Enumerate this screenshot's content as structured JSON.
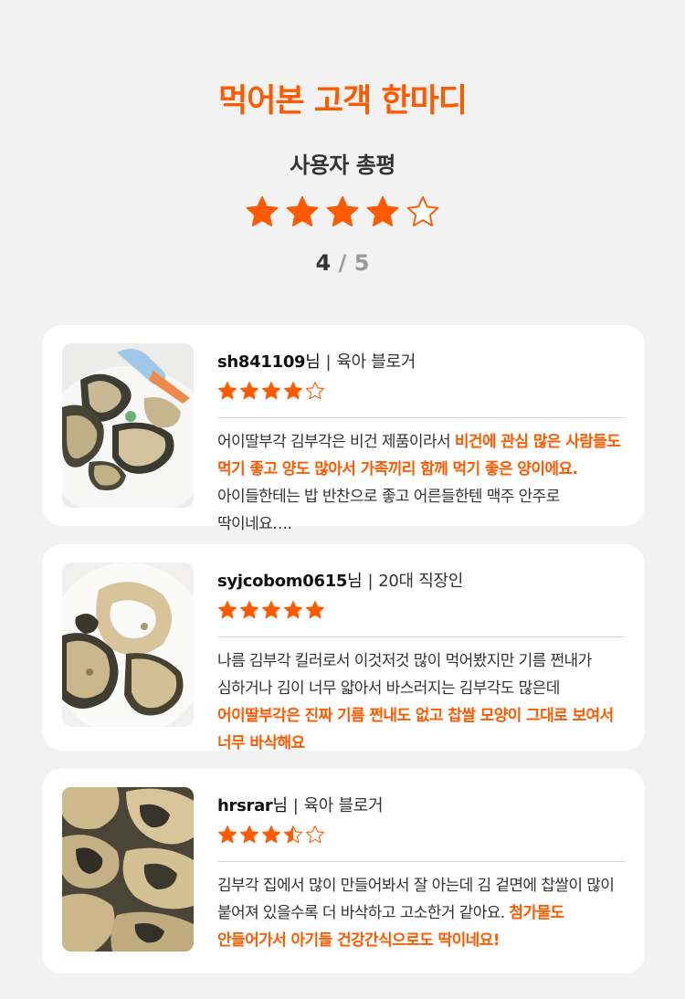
{
  "header": {
    "title": "먹어본 고객 한마디",
    "subtitle": "사용자 총평",
    "rating": 4,
    "score": "4",
    "score_sep": "/",
    "score_max": "5"
  },
  "colors": {
    "accent": "#ff5a00",
    "card_bg": "#ffffff",
    "page_bg": "#f2f2f2"
  },
  "reviews": [
    {
      "user_id": "sh841109",
      "suffix": "님",
      "separator": "|",
      "role": "육아 블로거",
      "rating": 4,
      "text_before": "어이딸부각 김부각은 비건 제품이라서 ",
      "highlight": "비건에 관심 많은 사람들도 먹기 좋고 양도 많아서 가족끼리 함께 먹기 좋은 양이에요.",
      "text_after": " 아이들한테는 밥 반찬으로 좋고 어른들한텐 맥주 안주로 딱이네요…."
    },
    {
      "user_id": "syjcobom0615",
      "suffix": "님",
      "separator": "|",
      "role": "20대 직장인",
      "rating": 5,
      "text_before": "나름 김부각 킬러로서 이것저것 많이 먹어봤지만 기름 쩐내가 심하거나 김이 너무 얇아서 바스러지는 김부각도 많은데 ",
      "highlight": "어이딸부각은 진짜 기름 쩐내도 없고 찹쌀 모양이 그대로 보여서 너무 바삭해요",
      "text_after": ""
    },
    {
      "user_id": "hrsrar",
      "suffix": "님",
      "separator": "|",
      "role": "육아 블로거",
      "rating": 3.5,
      "text_before": "김부각 집에서 많이 만들어봐서 잘 아는데 김 겉면에 찹쌀이 많이 붙어져 있을수록 더 바삭하고 고소한거 같아요. ",
      "highlight": "첨가물도 안들어가서 아기들 건강간식으로도 딱이네요!",
      "text_after": ""
    }
  ]
}
